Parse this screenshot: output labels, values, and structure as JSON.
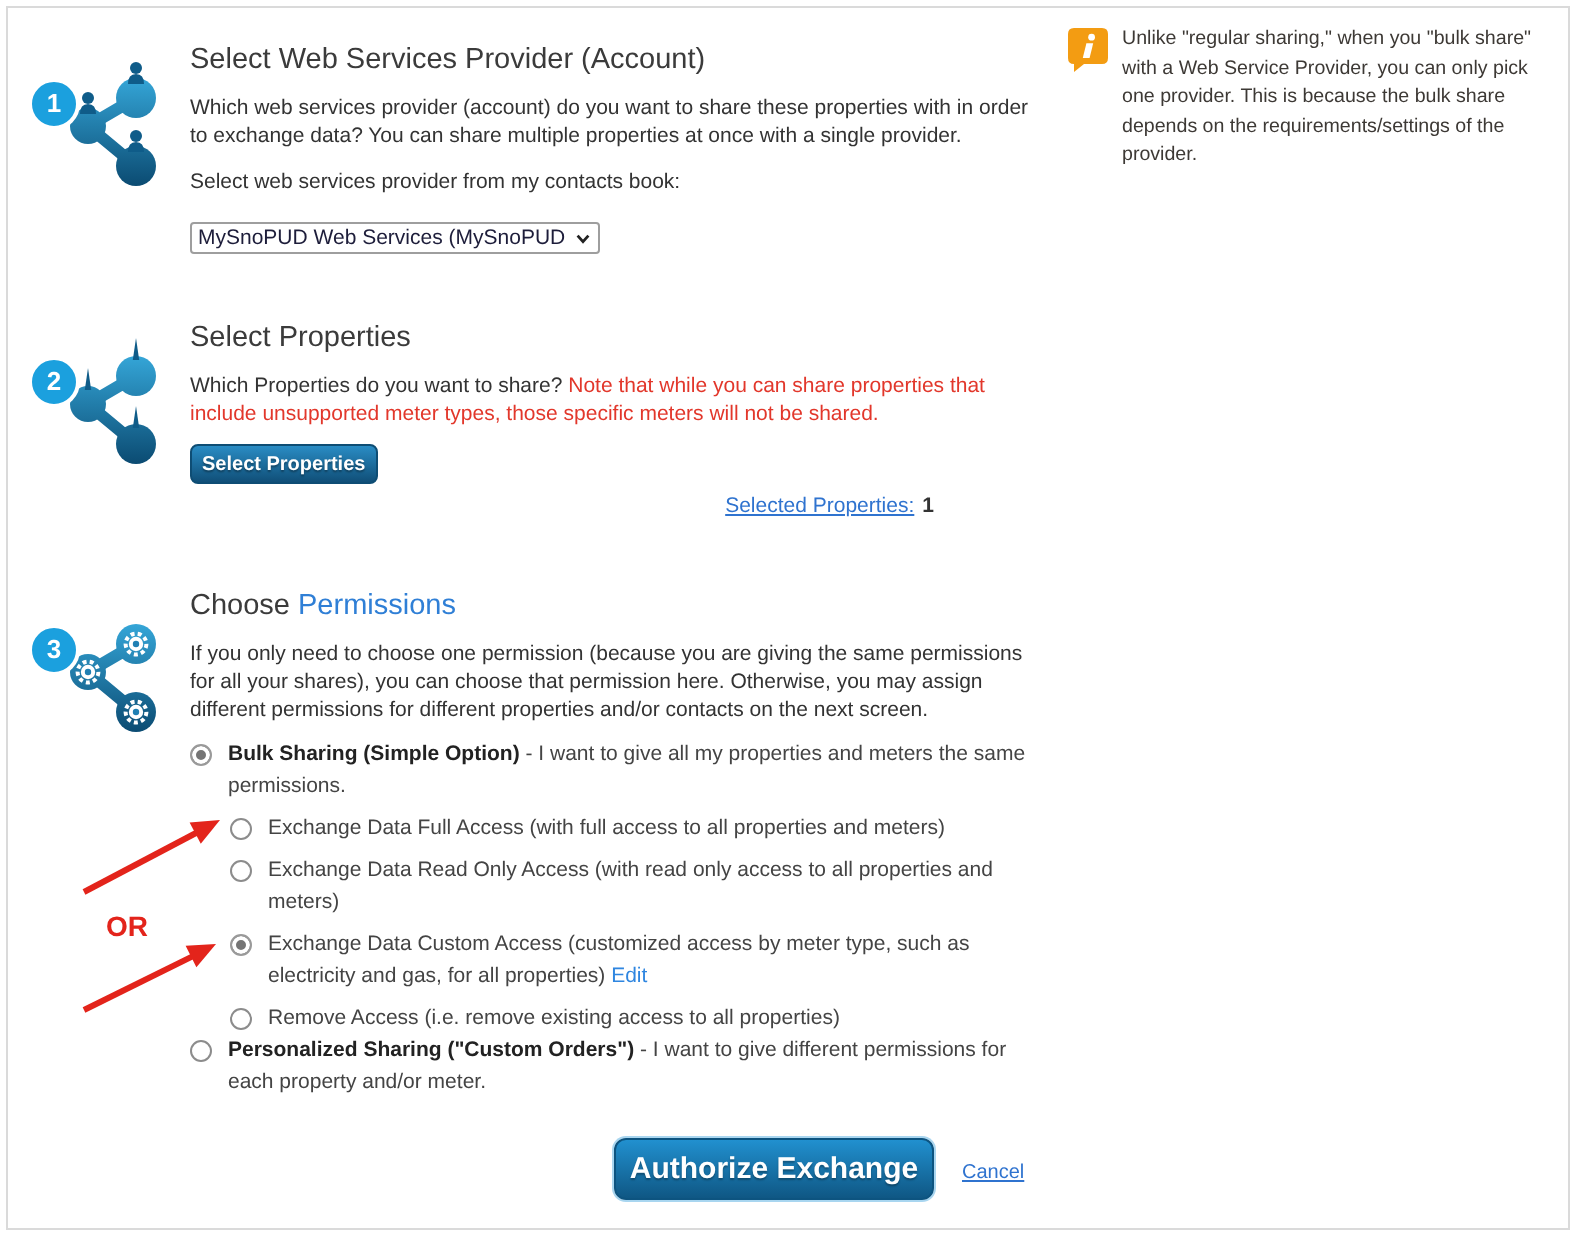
{
  "provider_step": {
    "number": "1",
    "title": "Select Web Services Provider (Account)",
    "description": "Which web services provider (account) do you want to share these properties with in order to exchange data? You can share multiple properties at once with a single provider.",
    "select_label": "Select web services provider from my contacts book:",
    "select_value": "MySnoPUD Web Services (MySnoPUD"
  },
  "properties_step": {
    "number": "2",
    "title": "Select Properties",
    "description": "Which Properties do you want to share?",
    "warning": "Note that while you can share properties that include unsupported meter types, those specific meters will not be shared.",
    "button": "Select Properties",
    "selected_link": "Selected Properties:",
    "selected_count": "1"
  },
  "permissions_step": {
    "number": "3",
    "title": "Choose",
    "title_accent": "Permissions",
    "description": "If you only need to choose one permission (because you are giving the same permissions for all your shares), you can choose that permission here. Otherwise, you may assign different permissions for different properties and/or contacts on the next screen.",
    "options": [
      {
        "label": "**Bulk Sharing (Simple Option)** - I want to give all my properties and meters the same permissions.",
        "selected": true,
        "children": [
          {
            "label": "Exchange Data Full Access (with full access to all properties and meters)",
            "selected": false
          },
          {
            "label": "Exchange Data Read Only Access (with read only access to all properties and meters)",
            "selected": false
          },
          {
            "label": "Exchange Data Custom Access (customized access by meter type, such as electricity and gas, for all properties)",
            "selected": true,
            "link": "Edit"
          },
          {
            "label": "Remove Access (i.e. remove existing access to all properties)",
            "selected": false
          }
        ]
      },
      {
        "label": "**Personalized Sharing (\"Custom Orders\")** - I want to give different permissions for each property and/or meter.",
        "selected": false
      }
    ]
  },
  "annotation": {
    "text": "OR"
  },
  "actions": {
    "authorize": "Authorize Exchange",
    "cancel": "Cancel"
  },
  "note": {
    "text": "Unlike \"regular sharing,\" when you \"bulk share\" with a Web Service Provider, you can only pick one provider. This is because the bulk share depends on the requirements/settings of the provider."
  }
}
